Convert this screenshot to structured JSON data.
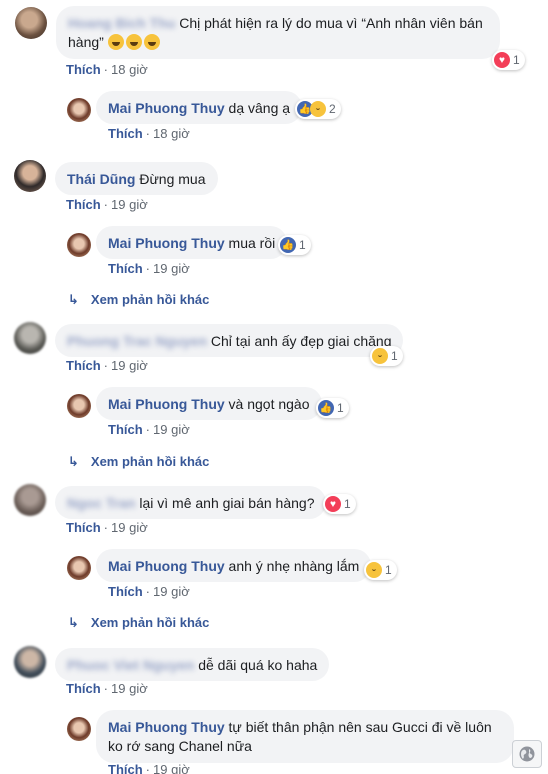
{
  "actions": {
    "like": "Thích",
    "more_replies": "Xem phản hồi khác",
    "dot": "·"
  },
  "comments": [
    {
      "name": "Hoang Bich Thu",
      "text": "Chị phát hiện ra lý do mua vì “Anh nhân viên bán hàng”",
      "time": "18 giờ",
      "reaction_count": "1"
    },
    {
      "name": "Mai Phuong Thuy",
      "text": "dạ vâng ạ",
      "time": "18 giờ",
      "reaction_count": "2"
    },
    {
      "name": "Thái Dũng",
      "text": "Đừng mua",
      "time": "19 giờ"
    },
    {
      "name": "Mai Phuong Thuy",
      "text": "mua rồi",
      "time": "19 giờ",
      "reaction_count": "1"
    },
    {
      "name": "Phuong Trac Nguyen",
      "text": "Chỉ tại anh ấy đẹp giai chăng",
      "time": "19 giờ",
      "reaction_count": "1"
    },
    {
      "name": "Mai Phuong Thuy",
      "text": "và ngọt ngào",
      "time": "19 giờ",
      "reaction_count": "1"
    },
    {
      "name": "Ngoc Tran",
      "text": "lại vì mê anh giai bán hàng?",
      "time": "19 giờ",
      "reaction_count": "1"
    },
    {
      "name": "Mai Phuong Thuy",
      "text": "anh ý nhẹ nhàng lắm",
      "time": "19 giờ",
      "reaction_count": "1"
    },
    {
      "name": "Phuoc Viet Nguyen",
      "text": "dễ dãi quá ko haha",
      "time": "19 giờ"
    },
    {
      "name": "Mai Phuong Thuy",
      "text": "tự biết thân phận nên sau Gucci đi về luôn ko rớ sang Chanel nữa",
      "time": "19 giờ"
    }
  ],
  "icons": {
    "like": "like-icon",
    "love": "love-icon",
    "haha": "haha-icon",
    "reply_arrow": "reply-arrow-icon",
    "globe": "globe-icon"
  }
}
